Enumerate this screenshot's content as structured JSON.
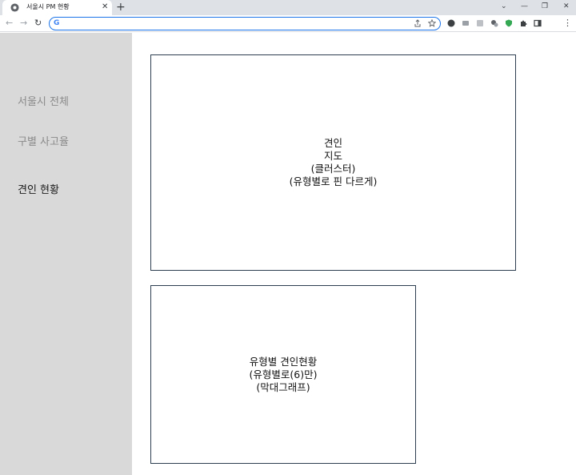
{
  "browser": {
    "tab_title": "서울시 PM 현황",
    "tab_close": "✕",
    "new_tab": "+",
    "controls": {
      "chevron": "⌄",
      "minimize": "—",
      "restore": "❐",
      "close": "✕"
    },
    "nav": {
      "back": "←",
      "forward": "→",
      "reload": "↻"
    },
    "omnibox": {
      "value": "",
      "badge": "G"
    },
    "menu": "⋮"
  },
  "sidebar": {
    "items": [
      {
        "label": "서울시 전체",
        "state": "inactive"
      },
      {
        "label": "구별 사고율",
        "state": "inactive"
      },
      {
        "label": "견인 현황",
        "state": "active"
      }
    ]
  },
  "panels": {
    "map": {
      "lines": [
        "견인",
        "지도",
        "(클러스터)",
        "(유형별로 핀 다르게)"
      ]
    },
    "bar": {
      "lines": [
        "유형별 견인현황",
        "(유형별로(6)만)",
        "(막대그래프)"
      ]
    }
  },
  "colors": {
    "sidebar_bg": "#d9d9d9",
    "panel_border": "#2d3e50",
    "inactive_text": "#8a8a8a",
    "active_text": "#1a1a1a",
    "omnibox_focus": "#1a73e8"
  }
}
